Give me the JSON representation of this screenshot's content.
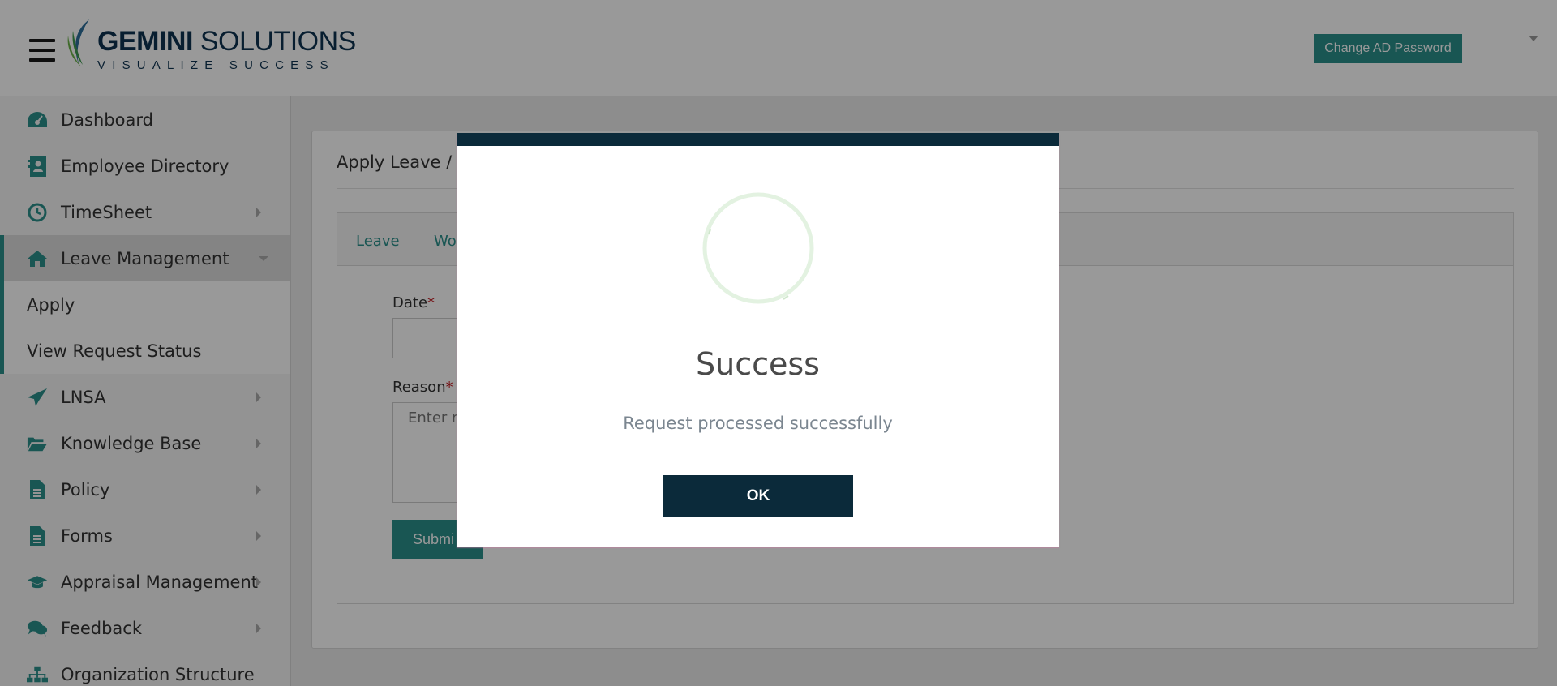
{
  "header": {
    "logo_bold": "GEMINI",
    "logo_light": "SOLUTIONS",
    "logo_tagline": "VISUALIZE SUCCESS",
    "change_password_label": "Change AD Password",
    "menu_icon": "hamburger-icon",
    "user_menu_icon": "caret-down-icon"
  },
  "sidebar": {
    "items": [
      {
        "label": "Dashboard",
        "icon": "dashboard-icon"
      },
      {
        "label": "Employee Directory",
        "icon": "address-book-icon"
      },
      {
        "label": "TimeSheet",
        "icon": "clock-icon"
      },
      {
        "label": "Leave Management",
        "icon": "home-icon"
      },
      {
        "label": "LNSA",
        "icon": "paper-plane-icon"
      },
      {
        "label": "Knowledge Base",
        "icon": "folder-open-icon"
      },
      {
        "label": "Policy",
        "icon": "document-icon"
      },
      {
        "label": "Forms",
        "icon": "file-icon"
      },
      {
        "label": "Appraisal Management",
        "icon": "graduation-cap-icon"
      },
      {
        "label": "Feedback",
        "icon": "comments-icon"
      },
      {
        "label": "Organization Structure",
        "icon": "sitemap-icon"
      }
    ],
    "sub_items": [
      "Apply",
      "View Request Status"
    ]
  },
  "main": {
    "title": "Apply Leave / W",
    "tabs": [
      "Leave",
      "Wo"
    ],
    "date_label": "Date",
    "reason_label": "Reason",
    "required_mark": "*",
    "reason_placeholder": "Enter re",
    "submit_label": "Submi"
  },
  "modal": {
    "title": "Success",
    "message": "Request processed successfully",
    "ok_label": "OK",
    "icon": "success-circle-icon"
  },
  "colors": {
    "accent": "#2a8f8b",
    "dark_navy": "#0b2a3a",
    "required": "#c0141b"
  }
}
